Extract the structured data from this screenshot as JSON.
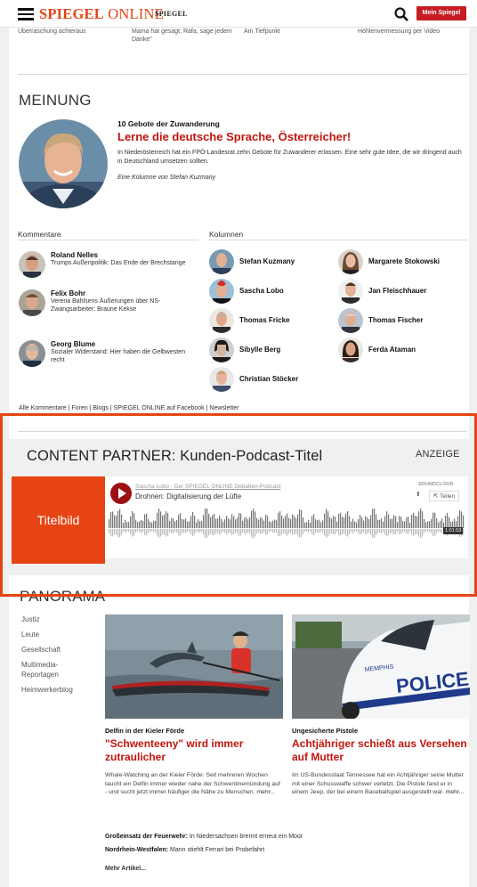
{
  "header": {
    "logo_spiegel": "SPIEGEL",
    "logo_online": "ONLINE",
    "logo_print": "SPIEGEL",
    "mein_spiegel": "Mein Spiegel"
  },
  "cut_teasers": [
    "Überraschung achteraus",
    "Mama hat gesagt, Rafa, sage jedem Danke\"",
    "Am Tiefpunkt",
    "Höhlenvermessung per Video"
  ],
  "meinung": {
    "title": "MEINUNG",
    "kicker": "10 Gebote der Zuwanderung",
    "headline": "Lerne die deutsche Sprache, Österreicher!",
    "teaser": "In Niederösterreich hat ein FPÖ-Landesrat zehn Gebote für Zuwanderer erlassen. Eine sehr gute Idee, die wir dringend auch in Deutschland umsetzen sollten.",
    "byline": "Eine Kolumne von Stefan Kuzmany",
    "kommentare_label": "Kommentare",
    "kolumnen_label": "Kolumnen",
    "kommentare": [
      {
        "name": "Roland Nelles",
        "text": "Trumps Außenpolitik: Das Ende der Brechstange"
      },
      {
        "name": "Felix Bohr",
        "text": "Verena Bahlsens Äußerungen über NS-Zwangsarbeiter: Braune Kekse"
      },
      {
        "name": "Georg Blume",
        "text": "Sozialer Widerstand: Hier haben die Gelbwesten recht"
      }
    ],
    "kolumnen_left": [
      "Stefan Kuzmany",
      "Sascha Lobo",
      "Thomas Fricke",
      "Sibylle Berg",
      "Christian Stöcker"
    ],
    "kolumnen_right": [
      "Margarete Stokowski",
      "Jan Fleischhauer",
      "Thomas Fischer",
      "Ferda Ataman"
    ],
    "footer_links": "Alle Kommentare | Foren | Blogs | SPIEGEL ONLINE auf Facebook | Newsletter"
  },
  "content_partner": {
    "title": "CONTENT PARTNER: Kunden-Podcast-Titel",
    "anzeige": "ANZEIGE",
    "titelbild": "Titelbild",
    "player": {
      "artist": "Sascha Lobo - Der SPIEGEL ONLINE Debatten-Podcast",
      "track": "Drohnen: Digitalisierung der Lüfte",
      "brand": "SOUNDCLOUD",
      "share": "Teilen",
      "duration": "1:01:53"
    }
  },
  "panorama": {
    "title": "PANORAMA",
    "nav": [
      "Justiz",
      "Leute",
      "Gesellschaft",
      "Multimedia-Reportagen",
      "Heimwerkerblog"
    ],
    "articles": [
      {
        "kicker": "Delfin in der Kieler Förde",
        "headline": "\"Schwenteeny\" wird immer zutraulicher",
        "teaser": "Whale-Watching an der Kieler Förde: Seit mehreren Wochen taucht ein Delfin immer wieder nahe der Schwentinemündung auf - und sucht jetzt immer häufiger die Nähe zu Menschen.",
        "more": "mehr..."
      },
      {
        "kicker": "Ungesicherte Pistole",
        "headline": "Achtjähriger schießt aus Versehen auf Mutter",
        "teaser": "Im US-Bundesstaat Tennessee hat ein Achtjähriger seine Mutter mit einer Schusswaffe schwer verletzt. Die Pistole fand er in einem Jeep, der bei einem Baseballspiel ausgestellt war.",
        "more": "mehr..."
      }
    ],
    "mini1_bold": "Großeinsatz der Feuerwehr:",
    "mini1_text": " In Niedersachsen brennt erneut ein Moor",
    "mini2_bold": "Nordrhein-Westfalen:",
    "mini2_text": " Mann stiehlt Ferrari bei Probefahrt",
    "more_articles": "Mehr Artikel...",
    "police_text": "POLICE",
    "police_small": "MEMPHIS"
  },
  "colors": {
    "accent": "#e64415",
    "headline": "#c2150f",
    "mein_spiegel_bg": "#c61d23"
  },
  "icons": [
    "hamburger-menu-icon",
    "search-icon",
    "play-icon",
    "download-icon",
    "share-icon"
  ]
}
